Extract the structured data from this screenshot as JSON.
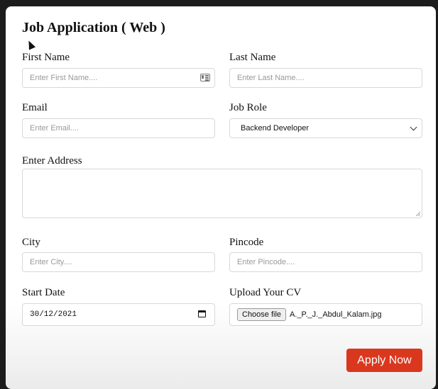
{
  "form": {
    "title": "Job Application ( Web )",
    "first_name": {
      "label": "First Name",
      "placeholder": "Enter First Name...."
    },
    "last_name": {
      "label": "Last Name",
      "placeholder": "Enter Last Name...."
    },
    "email": {
      "label": "Email",
      "placeholder": "Enter Email...."
    },
    "job_role": {
      "label": "Job Role",
      "selected": "Backend Developer"
    },
    "address": {
      "label": "Enter Address",
      "value": ""
    },
    "city": {
      "label": "City",
      "placeholder": "Enter City...."
    },
    "pincode": {
      "label": "Pincode",
      "placeholder": "Enter Pincode...."
    },
    "start_date": {
      "label": "Start Date",
      "value": "30/12/2021"
    },
    "cv": {
      "label": "Upload Your CV",
      "button": "Choose file",
      "file_name": "A._P._J._Abdul_Kalam.jpg"
    },
    "submit": "Apply Now"
  },
  "colors": {
    "accent": "#d9381e",
    "card": "#ffffff",
    "border": "#d8d8d8"
  },
  "icons": [
    "contact-card-icon",
    "chevron-down-icon",
    "calendar-icon",
    "mouse-cursor-icon"
  ]
}
